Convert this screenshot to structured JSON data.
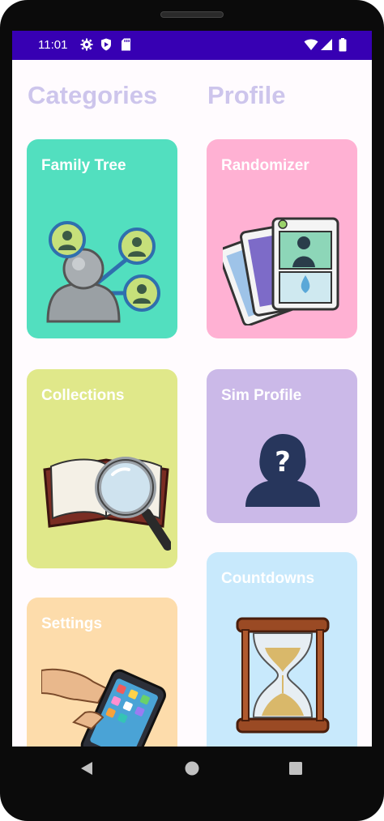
{
  "status_bar": {
    "time": "11:01",
    "icons": [
      "settings-icon",
      "shield-icon",
      "sd-card-icon"
    ],
    "right_icons": [
      "wifi-icon",
      "signal-icon",
      "battery-icon"
    ]
  },
  "headings": {
    "left": "Categories",
    "right": "Profile"
  },
  "cards": {
    "family_tree": {
      "label": "Family Tree",
      "color": "#52dfbf",
      "icon": "family-tree-icon"
    },
    "randomizer": {
      "label": "Randomizer",
      "color": "#ffb1d3",
      "icon": "cards-icon"
    },
    "collections": {
      "label": "Collections",
      "color": "#e0e88a",
      "icon": "book-magnifier-icon"
    },
    "sim_profile": {
      "label": "Sim Profile",
      "color": "#cbb9e8",
      "icon": "silhouette-question-icon"
    },
    "settings": {
      "label": "Settings",
      "color": "#fddcab",
      "icon": "phone-hand-icon"
    },
    "countdowns": {
      "label": "Countdowns",
      "color": "#c8e9fc",
      "icon": "hourglass-icon"
    }
  },
  "nav": [
    "back-icon",
    "home-icon",
    "recents-icon"
  ]
}
